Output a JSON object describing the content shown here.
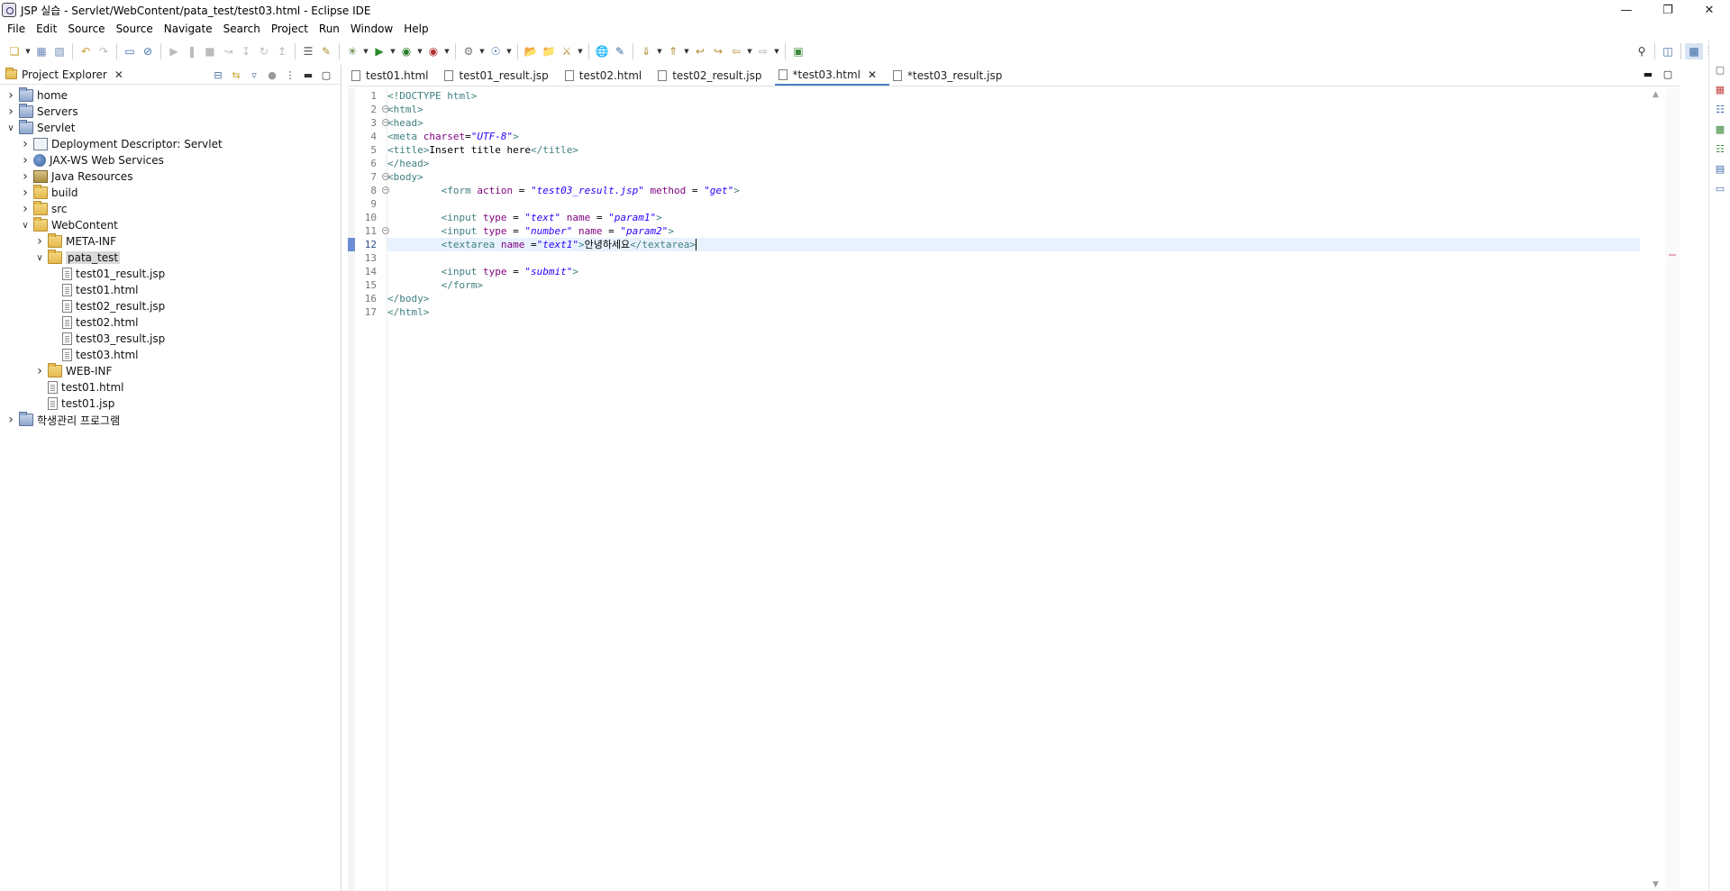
{
  "window": {
    "title": "JSP 실습 - Servlet/WebContent/pata_test/test03.html - Eclipse IDE",
    "controls": [
      "minimize-icon",
      "restore-icon",
      "close-icon"
    ]
  },
  "menu": [
    "File",
    "Edit",
    "Source",
    "Source",
    "Navigate",
    "Search",
    "Project",
    "Run",
    "Window",
    "Help"
  ],
  "explorer": {
    "title": "Project Explorer",
    "tree": [
      {
        "label": "home",
        "depth": 0,
        "expanded": false,
        "icon": "project"
      },
      {
        "label": "Servers",
        "depth": 0,
        "expanded": false,
        "icon": "project"
      },
      {
        "label": "Servlet",
        "depth": 0,
        "expanded": true,
        "icon": "project"
      },
      {
        "label": "Deployment Descriptor: Servlet",
        "depth": 1,
        "expanded": false,
        "icon": "descriptor"
      },
      {
        "label": "JAX-WS Web Services",
        "depth": 1,
        "expanded": false,
        "icon": "webservice"
      },
      {
        "label": "Java Resources",
        "depth": 1,
        "expanded": false,
        "icon": "library"
      },
      {
        "label": "build",
        "depth": 1,
        "expanded": false,
        "icon": "folder"
      },
      {
        "label": "src",
        "depth": 1,
        "expanded": false,
        "icon": "folder"
      },
      {
        "label": "WebContent",
        "depth": 1,
        "expanded": true,
        "icon": "folder"
      },
      {
        "label": "META-INF",
        "depth": 2,
        "expanded": false,
        "icon": "folder"
      },
      {
        "label": "pata_test",
        "depth": 2,
        "expanded": true,
        "icon": "folder",
        "selected": true
      },
      {
        "label": "test01_result.jsp",
        "depth": 3,
        "icon": "file"
      },
      {
        "label": "test01.html",
        "depth": 3,
        "icon": "file"
      },
      {
        "label": "test02_result.jsp",
        "depth": 3,
        "icon": "file"
      },
      {
        "label": "test02.html",
        "depth": 3,
        "icon": "file"
      },
      {
        "label": "test03_result.jsp",
        "depth": 3,
        "icon": "file"
      },
      {
        "label": "test03.html",
        "depth": 3,
        "icon": "file"
      },
      {
        "label": "WEB-INF",
        "depth": 2,
        "expanded": false,
        "icon": "folder"
      },
      {
        "label": "test01.html",
        "depth": 2,
        "icon": "file"
      },
      {
        "label": "test01.jsp",
        "depth": 2,
        "icon": "file"
      },
      {
        "label": "학생관리 프로그램",
        "depth": 0,
        "expanded": false,
        "icon": "project"
      }
    ]
  },
  "editor": {
    "tabs": [
      {
        "label": "test01.html",
        "active": false
      },
      {
        "label": "test01_result.jsp",
        "active": false
      },
      {
        "label": "test02.html",
        "active": false
      },
      {
        "label": "test02_result.jsp",
        "active": false
      },
      {
        "label": "*test03.html",
        "active": true
      },
      {
        "label": "*test03_result.jsp",
        "active": false
      }
    ],
    "current_line": 12,
    "lines": [
      {
        "n": "1",
        "fold": false,
        "tokens": [
          [
            "tag",
            "<!DOCTYPE html>"
          ]
        ]
      },
      {
        "n": "2",
        "fold": true,
        "tokens": [
          [
            "tag",
            "<html>"
          ]
        ]
      },
      {
        "n": "3",
        "fold": true,
        "tokens": [
          [
            "tag",
            "<head>"
          ]
        ]
      },
      {
        "n": "4",
        "fold": false,
        "tokens": [
          [
            "tag",
            "<meta "
          ],
          [
            "attr",
            "charset"
          ],
          [
            "txt",
            "="
          ],
          [
            "val",
            "\"UTF-8\""
          ],
          [
            "tag",
            ">"
          ]
        ]
      },
      {
        "n": "5",
        "fold": false,
        "tokens": [
          [
            "tag",
            "<title>"
          ],
          [
            "txt",
            "Insert title here"
          ],
          [
            "tag",
            "</title>"
          ]
        ]
      },
      {
        "n": "6",
        "fold": false,
        "tokens": [
          [
            "tag",
            "</head>"
          ]
        ]
      },
      {
        "n": "7",
        "fold": true,
        "tokens": [
          [
            "tag",
            "<body>"
          ]
        ]
      },
      {
        "n": "8",
        "fold": true,
        "tokens": [
          [
            "txt",
            "         "
          ],
          [
            "tag",
            "<form "
          ],
          [
            "attr",
            "action"
          ],
          [
            "txt",
            " = "
          ],
          [
            "val",
            "\"test03_result.jsp\""
          ],
          [
            "txt",
            " "
          ],
          [
            "attr",
            "method"
          ],
          [
            "txt",
            " = "
          ],
          [
            "val",
            "\"get\""
          ],
          [
            "tag",
            ">"
          ]
        ]
      },
      {
        "n": "9",
        "fold": false,
        "tokens": []
      },
      {
        "n": "10",
        "fold": false,
        "tokens": [
          [
            "txt",
            "         "
          ],
          [
            "tag",
            "<input "
          ],
          [
            "attr",
            "type"
          ],
          [
            "txt",
            " = "
          ],
          [
            "val",
            "\"text\""
          ],
          [
            "txt",
            " "
          ],
          [
            "attr",
            "name"
          ],
          [
            "txt",
            " = "
          ],
          [
            "val",
            "\"param1\""
          ],
          [
            "tag",
            ">"
          ]
        ]
      },
      {
        "n": "11",
        "fold": true,
        "tokens": [
          [
            "txt",
            "         "
          ],
          [
            "tag",
            "<input "
          ],
          [
            "attr",
            "type"
          ],
          [
            "txt",
            " = "
          ],
          [
            "val",
            "\"number\""
          ],
          [
            "txt",
            " "
          ],
          [
            "attr",
            "name"
          ],
          [
            "txt",
            " = "
          ],
          [
            "val",
            "\"param2\""
          ],
          [
            "tag",
            ">"
          ]
        ]
      },
      {
        "n": "12",
        "fold": false,
        "tokens": [
          [
            "txt",
            "         "
          ],
          [
            "tag",
            "<textarea "
          ],
          [
            "attr",
            "name"
          ],
          [
            "txt",
            " ="
          ],
          [
            "val",
            "\"text1\""
          ],
          [
            "tag",
            ">"
          ],
          [
            "txt",
            "안녕하세요"
          ],
          [
            "tag",
            "</textarea>"
          ]
        ]
      },
      {
        "n": "13",
        "fold": false,
        "tokens": []
      },
      {
        "n": "14",
        "fold": false,
        "tokens": [
          [
            "txt",
            "         "
          ],
          [
            "tag",
            "<input "
          ],
          [
            "attr",
            "type"
          ],
          [
            "txt",
            " = "
          ],
          [
            "val",
            "\"submit\""
          ],
          [
            "tag",
            ">"
          ]
        ]
      },
      {
        "n": "15",
        "fold": false,
        "tokens": [
          [
            "txt",
            "         "
          ],
          [
            "tag",
            "</form>"
          ]
        ]
      },
      {
        "n": "16",
        "fold": false,
        "tokens": [
          [
            "tag",
            "</body>"
          ]
        ]
      },
      {
        "n": "17",
        "fold": false,
        "tokens": [
          [
            "tag",
            "</html>"
          ]
        ]
      }
    ]
  },
  "colors": {
    "tag": "#3f7f7f",
    "attr": "#7f007f",
    "value": "#2a00ff",
    "current_line": "#e8f2fe",
    "active_tab_underline": "#4a7fc1"
  }
}
